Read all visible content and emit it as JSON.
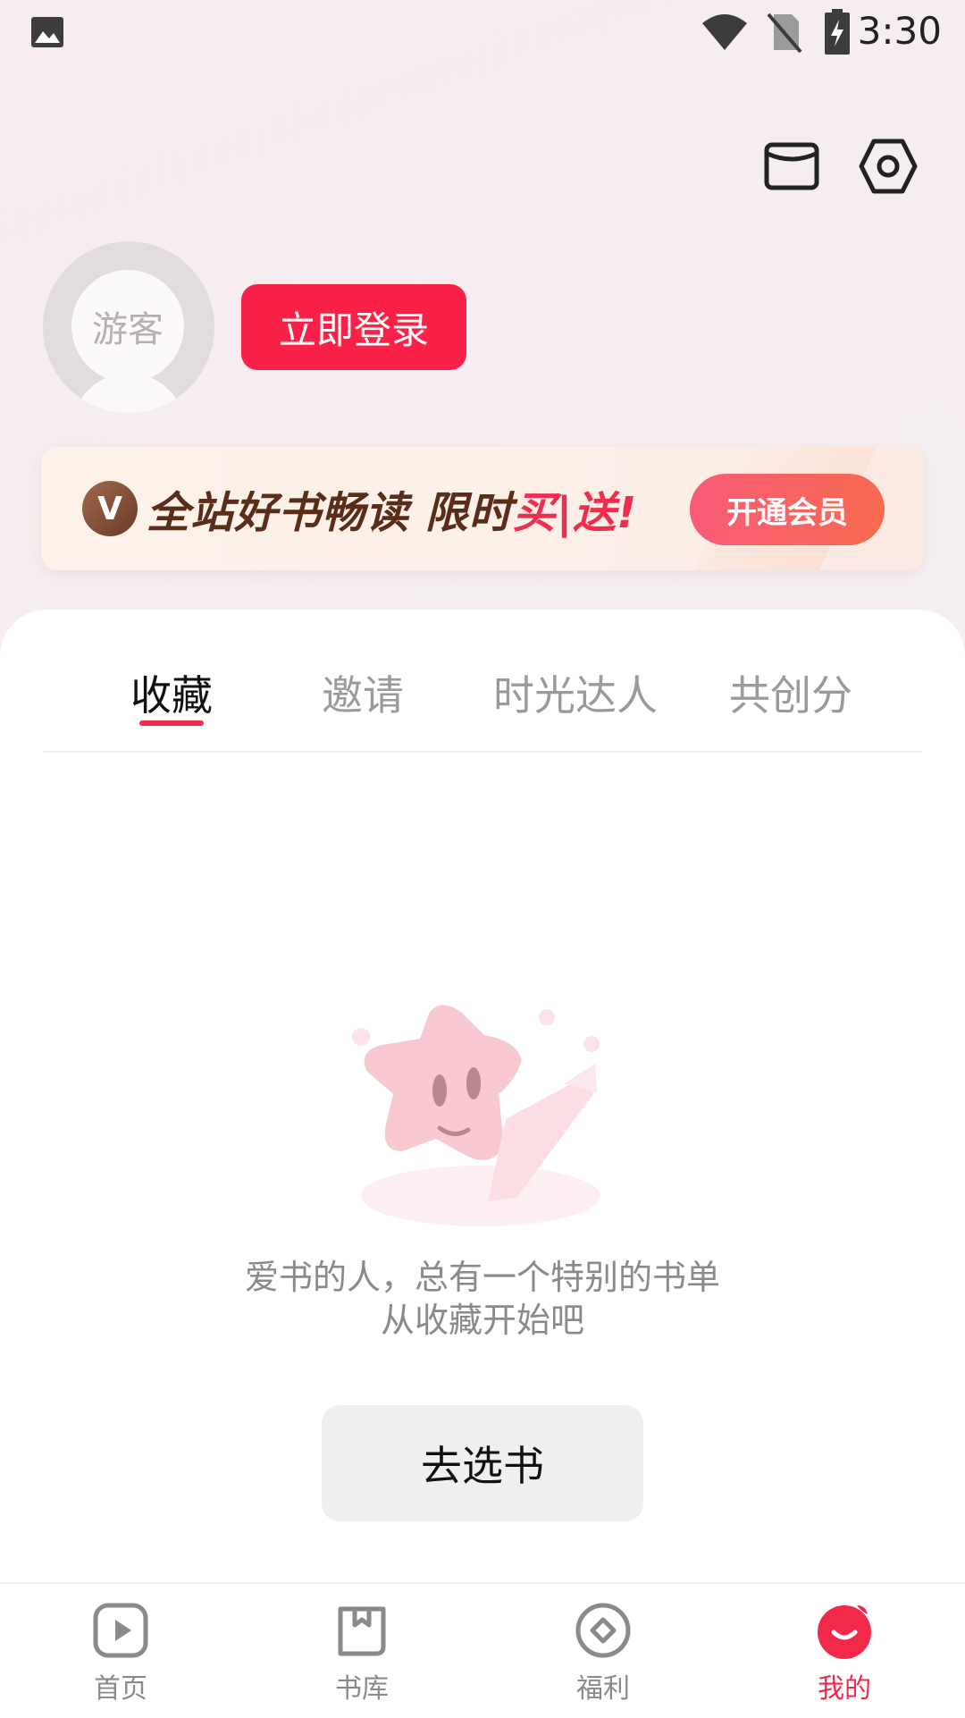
{
  "status_bar": {
    "time": "3:30"
  },
  "user": {
    "avatar_text": "游客",
    "login_label": "立即登录"
  },
  "vip_banner": {
    "logo_glyph": "V",
    "text_main": "全站好书畅读 限时",
    "text_highlight": "买|送!",
    "cta_label": "开通会员"
  },
  "tabs": [
    {
      "label": "收藏",
      "active": true
    },
    {
      "label": "邀请"
    },
    {
      "label": "时光达人"
    },
    {
      "label": "共创分"
    }
  ],
  "empty_state": {
    "line1": "爱书的人，总有一个特别的书单",
    "line2": "从收藏开始吧",
    "button_label": "去选书"
  },
  "bottom_nav": [
    {
      "label": "首页",
      "icon": "play-icon"
    },
    {
      "label": "书库",
      "icon": "library-icon"
    },
    {
      "label": "福利",
      "icon": "coin-icon"
    },
    {
      "label": "我的",
      "icon": "profile-smile-icon",
      "active": true
    }
  ],
  "colors": {
    "accent": "#f2294b",
    "login_button": "#fa2148"
  }
}
